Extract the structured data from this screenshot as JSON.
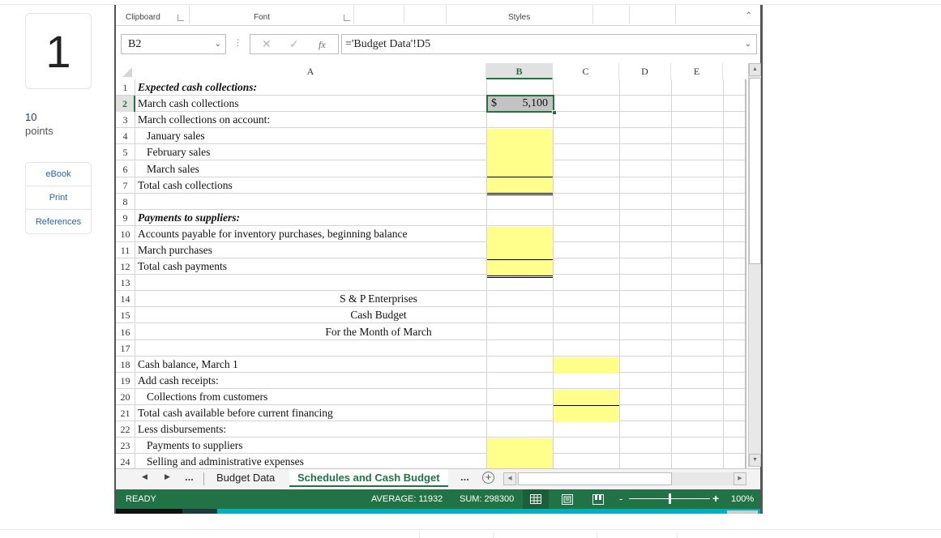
{
  "question": {
    "number": "1",
    "points_value": "10",
    "points_label": "points",
    "resources": [
      "eBook",
      "Print",
      "References"
    ]
  },
  "ribbon": {
    "groups": [
      "Clipboard",
      "Font",
      "Styles"
    ],
    "collapse_icon": "chevron-up-icon"
  },
  "formula_bar": {
    "name_box": "B2",
    "cancel_icon": "✕",
    "enter_icon": "✓",
    "fx_label": "fx",
    "formula": "='Budget Data'!D5"
  },
  "columns": [
    "A",
    "B",
    "C",
    "D",
    "E"
  ],
  "selected_column": "B",
  "selected_row": "2",
  "rows": [
    {
      "num": "1",
      "a": "Expected cash collections:",
      "style": "bi"
    },
    {
      "num": "2",
      "a": "March cash collections",
      "style": ""
    },
    {
      "num": "3",
      "a": "March collections on account:",
      "style": ""
    },
    {
      "num": "4",
      "a": "January sales",
      "style": "indent"
    },
    {
      "num": "5",
      "a": "February sales",
      "style": "indent"
    },
    {
      "num": "6",
      "a": "March sales",
      "style": "indent"
    },
    {
      "num": "7",
      "a": "Total cash collections",
      "style": ""
    },
    {
      "num": "8",
      "a": "",
      "style": ""
    },
    {
      "num": "9",
      "a": "Payments to suppliers:",
      "style": "bi"
    },
    {
      "num": "10",
      "a": "Accounts payable for inventory purchases, beginning balance",
      "style": ""
    },
    {
      "num": "11",
      "a": "March purchases",
      "style": ""
    },
    {
      "num": "12",
      "a": "Total cash payments",
      "style": ""
    },
    {
      "num": "13",
      "a": "",
      "style": ""
    },
    {
      "num": "14",
      "a": "S & P Enterprises",
      "style": "center"
    },
    {
      "num": "15",
      "a": "Cash Budget",
      "style": "center"
    },
    {
      "num": "16",
      "a": "For the Month of March",
      "style": "center"
    },
    {
      "num": "17",
      "a": "",
      "style": ""
    },
    {
      "num": "18",
      "a": "Cash balance, March 1",
      "style": ""
    },
    {
      "num": "19",
      "a": "Add cash receipts:",
      "style": ""
    },
    {
      "num": "20",
      "a": "Collections from customers",
      "style": "indent"
    },
    {
      "num": "21",
      "a": "Total cash available before current financing",
      "style": ""
    },
    {
      "num": "22",
      "a": "Less disbursements:",
      "style": ""
    },
    {
      "num": "23",
      "a": "Payments to suppliers",
      "style": "indent"
    },
    {
      "num": "24",
      "a": "Selling and administrative expenses",
      "style": "indent"
    }
  ],
  "active_cell": {
    "ref": "B2",
    "currency": "$",
    "value": "5,100"
  },
  "sheet_tabs": {
    "tabs": [
      "Budget Data",
      "Schedules and Cash Budget"
    ],
    "active": "Schedules and Cash Budget",
    "more": "...",
    "add_icon": "+"
  },
  "status_bar": {
    "mode": "READY",
    "average": "AVERAGE: 11932",
    "sum": "SUM: 298300",
    "zoom": "100%",
    "zoom_fraction": 0.5
  },
  "colors": {
    "excel_green": "#217346",
    "input_yellow": "#ffff8c",
    "link_blue": "#2a62b0"
  }
}
